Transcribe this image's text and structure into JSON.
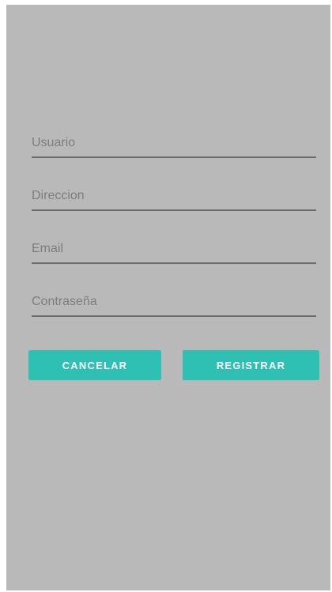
{
  "form": {
    "fields": [
      {
        "placeholder": "Usuario",
        "value": ""
      },
      {
        "placeholder": "Direccion",
        "value": ""
      },
      {
        "placeholder": "Email",
        "value": ""
      },
      {
        "placeholder": "Contraseña",
        "value": ""
      }
    ]
  },
  "buttons": {
    "cancel_label": "CANCELAR",
    "register_label": "REGISTRAR"
  },
  "colors": {
    "background": "#b9b9b9",
    "accent": "#2ec1b3",
    "field_underline": "#6a6a6a"
  }
}
